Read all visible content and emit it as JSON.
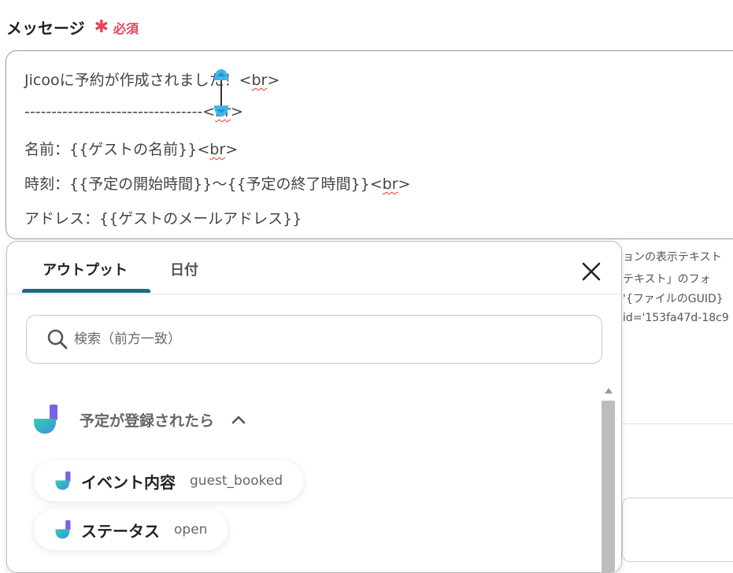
{
  "field": {
    "label": "メッセージ",
    "required_star": "✱",
    "required_text": "必須"
  },
  "message": {
    "lines": [
      {
        "text": "Jicooに予約が作成されました！<",
        "tag": "br",
        "suffix": ">"
      },
      {
        "text": "---------------------------------<",
        "tag": "br",
        "suffix": ">"
      },
      {
        "text": "名前：{{ゲストの名前}}<",
        "tag": "br",
        "suffix": ">"
      },
      {
        "text": "時刻：{{予定の開始時間}}〜{{予定の終了時間}}<",
        "tag": "br",
        "suffix": ">"
      },
      {
        "text": "アドレス：{{ゲストのメールアドレス}}",
        "tag": "",
        "suffix": ""
      }
    ]
  },
  "background_help": {
    "lines": [
      "ョンの表示テキスト",
      "テキスト」のフォ",
      "'{ファイルのGUID}",
      "id='153fa47d-18c9"
    ]
  },
  "popover": {
    "tabs": [
      {
        "label": "アウトプット",
        "active": true
      },
      {
        "label": "日付",
        "active": false
      }
    ],
    "search_placeholder": "検索（前方一致）",
    "section_title": "予定が登録されたら",
    "items": [
      {
        "key": "イベント内容",
        "value": "guest_booked"
      },
      {
        "key": "ステータス",
        "value": "open"
      }
    ]
  },
  "colors": {
    "required": "#e8435a",
    "tab_underline": "#1c6b86",
    "spell_underline": "#e53935",
    "cursor_handle": "#3fb6f0"
  }
}
